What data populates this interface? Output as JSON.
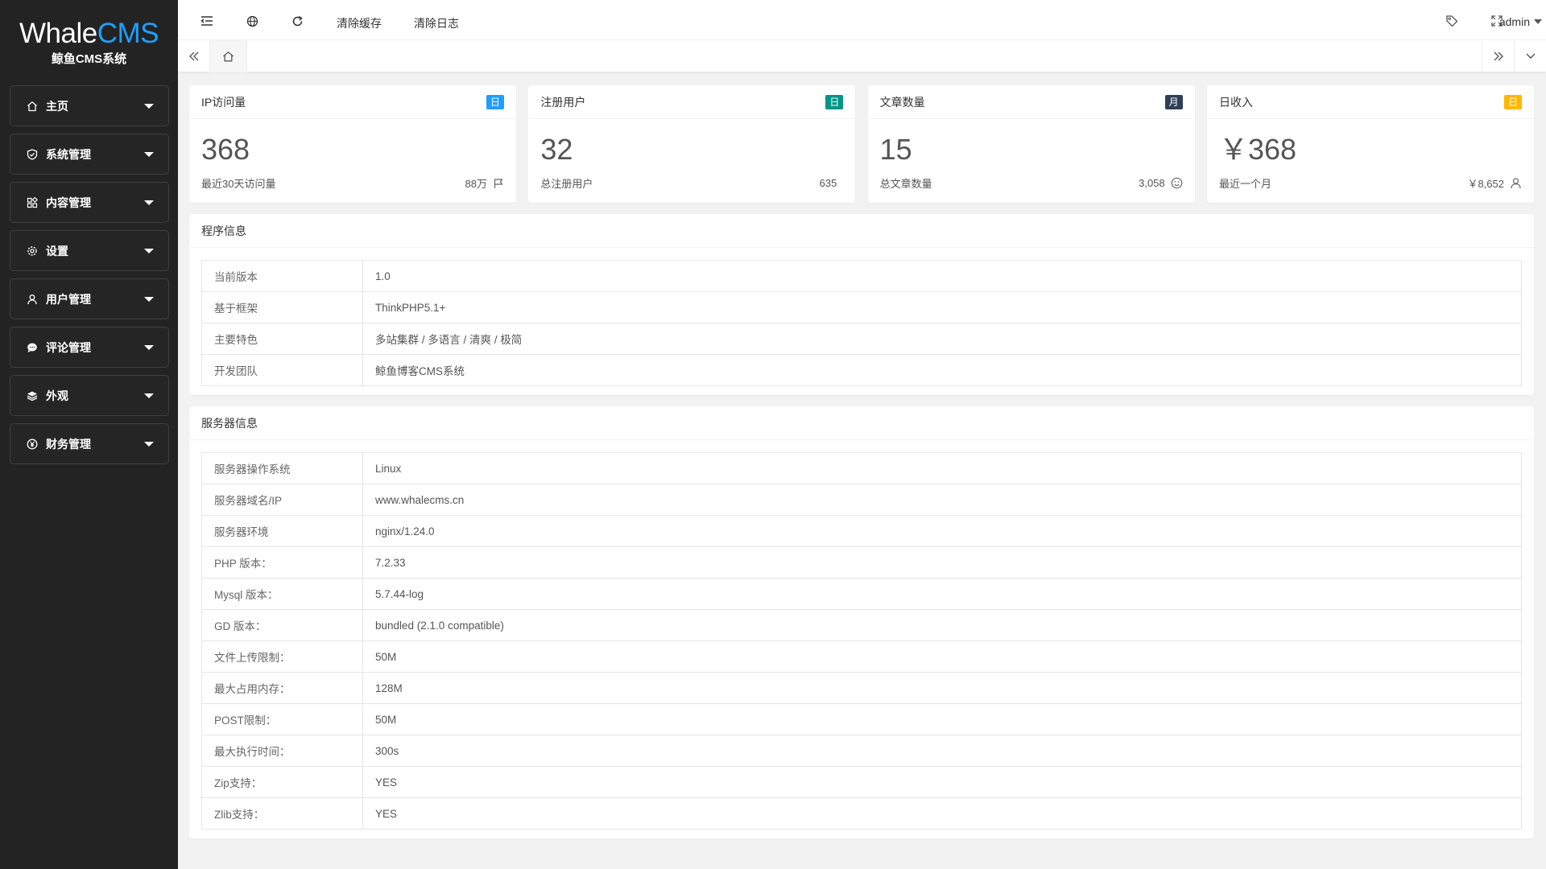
{
  "brand": {
    "logo_white": "Whale",
    "logo_blue": "CMS",
    "subtitle": "鲸鱼CMS系统"
  },
  "colors": {
    "sidebar_bg": "#232323",
    "accent_blue": "#1e9fff",
    "accent_green": "#009688",
    "accent_dark": "#2f4056",
    "accent_orange": "#ffb800"
  },
  "sidebar": {
    "items": [
      {
        "label": "主页",
        "icon": "home-icon"
      },
      {
        "label": "系统管理",
        "icon": "shield-icon"
      },
      {
        "label": "内容管理",
        "icon": "apps-icon"
      },
      {
        "label": "设置",
        "icon": "gear-icon"
      },
      {
        "label": "用户管理",
        "icon": "user-icon"
      },
      {
        "label": "评论管理",
        "icon": "chat-icon"
      },
      {
        "label": "外观",
        "icon": "layers-icon"
      },
      {
        "label": "财务管理",
        "icon": "yen-icon"
      }
    ]
  },
  "header": {
    "clear_cache": "清除缓存",
    "clear_log": "清除日志",
    "user": "admin"
  },
  "cards": [
    {
      "title": "IP访问量",
      "badge": "日",
      "badge_color": "#1e9fff",
      "value": "368",
      "desc": "最近30天访问量",
      "sub_value": "88万",
      "icon": "flag-icon"
    },
    {
      "title": "注册用户",
      "badge": "日",
      "badge_color": "#009688",
      "value": "32",
      "desc": "总注册用户",
      "sub_value": "635",
      "icon": ""
    },
    {
      "title": "文章数量",
      "badge": "月",
      "badge_color": "#2f4056",
      "value": "15",
      "desc": "总文章数量",
      "sub_value": "3,058",
      "icon": "smile-icon"
    },
    {
      "title": "日收入",
      "badge": "日",
      "badge_color": "#ffb800",
      "value": "￥368",
      "desc": "最近一个月",
      "sub_value": "￥8,652",
      "icon": "user-icon"
    }
  ],
  "program_info": {
    "title": "程序信息",
    "rows": [
      {
        "key": "当前版本",
        "value": "1.0"
      },
      {
        "key": "基于框架",
        "value": "ThinkPHP5.1+"
      },
      {
        "key": "主要特色",
        "value": "多站集群 / 多语言 / 清爽 / 极简"
      },
      {
        "key": "开发团队",
        "value": "鲸鱼博客CMS系统"
      }
    ]
  },
  "server_info": {
    "title": "服务器信息",
    "rows": [
      {
        "key": "服务器操作系统",
        "value": "Linux"
      },
      {
        "key": "服务器域名/IP",
        "value": "www.whalecms.cn"
      },
      {
        "key": "服务器环境",
        "value": "nginx/1.24.0"
      },
      {
        "key": "PHP 版本：",
        "value": "7.2.33"
      },
      {
        "key": "Mysql 版本：",
        "value": "5.7.44-log"
      },
      {
        "key": "GD 版本：",
        "value": "bundled (2.1.0 compatible)"
      },
      {
        "key": "文件上传限制：",
        "value": "50M"
      },
      {
        "key": "最大占用内存：",
        "value": "128M"
      },
      {
        "key": "POST限制：",
        "value": "50M"
      },
      {
        "key": "最大执行时间：",
        "value": "300s"
      },
      {
        "key": "Zip支持：",
        "value": "YES"
      },
      {
        "key": "Zlib支持：",
        "value": "YES"
      }
    ]
  }
}
